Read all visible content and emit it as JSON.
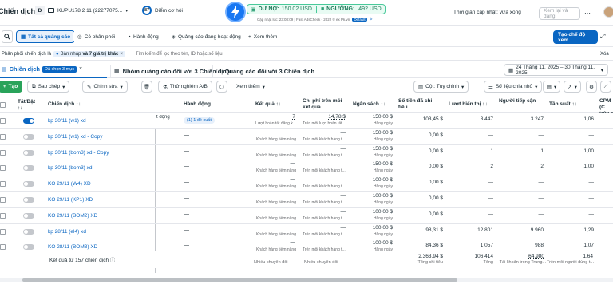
{
  "top": {
    "title": "Chiến dịch",
    "account_badge": "D",
    "account_name": "KUPU178 2 11 (22277075...",
    "opp_score": "87",
    "opp_label": "Điểm cơ hội",
    "debt_label": "DƯ NỢ:",
    "debt_value": "150.02 USD",
    "threshold_label": "NGƯỠNG:",
    "threshold_value": "492 USD",
    "updated_sub": "Cập nhật lúc: 23:08:09 | Fast AdsCheck - 2022 © ex Pk.vn",
    "default_pill": "Default",
    "update_time_label": "Thời gian cập nhật: vừa xong",
    "review_edit_btn": "Xem lại và đăng"
  },
  "tabs_bar": {
    "all_ads": "Tất cả quảng cáo",
    "having_delivery": "Có phân phối",
    "actions": "Hành động",
    "active_ads": "Quảng cáo đang hoạt động",
    "see_more": "Xem thêm",
    "create_view": "Tạo chế độ xem"
  },
  "filter_bar": {
    "filter_prefix": "Phân phối chiến dịch là",
    "filter_value_a": "Bản nháp",
    "filter_value_b": "và 7 giá trị khác",
    "search_placeholder": "Tìm kiếm để lọc theo tên, ID hoặc số liệu",
    "clear": "Xóa"
  },
  "level_tabs": {
    "campaigns": "Chiến dịch",
    "selected": "Đã chọn 3 mục",
    "adsets": "Nhóm quảng cáo đối với 3 Chiến dịch",
    "ads": "Quảng cáo đối với 3 Chiến dịch",
    "date_range": "24 Tháng 11, 2025 – 30 Tháng 11, 2025"
  },
  "toolbar": {
    "create": "Tạo",
    "duplicate": "Sao chép",
    "edit": "Chỉnh sửa",
    "ab_test": "Thử nghiệm A/B",
    "see_more": "Xem thêm",
    "columns": "Cột: Tùy chỉnh",
    "breakdown": "Số liệu chia nhỏ"
  },
  "columns": {
    "onoff": "Tắt/Bật",
    "campaign": "Chiến dịch",
    "action": "Hành động",
    "results": "Kết quả",
    "cost_per_result": "Chi phí trên mỗi kết quả",
    "budget": "Ngân sách",
    "amount_spent": "Số tiền đã chi tiêu",
    "impressions": "Lượt hiển thị",
    "reach": "Người tiếp cận",
    "frequency": "Tần suất",
    "cpm": "CPM (C trên m"
  },
  "rows": [
    {
      "name": "kp 30/11 (w1) xd",
      "on": true,
      "action": "(1) 1 đề xuất",
      "action_left": "t động",
      "results": "7",
      "results_sub": "Lượt hoàn tất đăng k...",
      "cpr": "14,78 $",
      "cpr_sub": "Trên mỗi lượt hoàn tất...",
      "budget": "150,00 $",
      "budget_sub": "Hằng ngày",
      "spent": "103,45 $",
      "impr": "3.447",
      "reach": "3.247",
      "freq": "1,06"
    },
    {
      "name": "kp 30/11 (w1) xd - Copy",
      "on": false,
      "action": "—",
      "action_left": "",
      "results": "—",
      "results_sub": "Khách hàng tiềm năng",
      "cpr": "—",
      "cpr_sub": "Trên mỗi khách hàng t...",
      "budget": "150,00 $",
      "budget_sub": "Hằng ngày",
      "spent": "0,00 $",
      "impr": "—",
      "reach": "—",
      "freq": "—"
    },
    {
      "name": "kp 30/11 (bom3) xd - Copy",
      "on": false,
      "action": "—",
      "action_left": "",
      "results": "—",
      "results_sub": "Khách hàng tiềm năng",
      "cpr": "—",
      "cpr_sub": "Trên mỗi khách hàng t...",
      "budget": "150,00 $",
      "budget_sub": "Hằng ngày",
      "spent": "0,00 $",
      "impr": "1",
      "reach": "1",
      "freq": "1,00"
    },
    {
      "name": "kp 30/11 (bom3) xd",
      "on": false,
      "action": "—",
      "action_left": "",
      "results": "—",
      "results_sub": "Khách hàng tiềm năng",
      "cpr": "—",
      "cpr_sub": "Trên mỗi khách hàng t...",
      "budget": "150,00 $",
      "budget_sub": "Hằng ngày",
      "spent": "0,00 $",
      "impr": "2",
      "reach": "2",
      "freq": "1,00"
    },
    {
      "name": "KO 29/11 (W4) XD",
      "on": false,
      "action": "—",
      "action_left": "",
      "results": "—",
      "results_sub": "Khách hàng tiềm năng",
      "cpr": "—",
      "cpr_sub": "Trên mỗi khách hàng t...",
      "budget": "100,00 $",
      "budget_sub": "Hằng ngày",
      "spent": "0,00 $",
      "impr": "—",
      "reach": "—",
      "freq": "—"
    },
    {
      "name": "KO 29/11 (KP1) XD",
      "on": false,
      "action": "—",
      "action_left": "",
      "results": "—",
      "results_sub": "Khách hàng tiềm năng",
      "cpr": "—",
      "cpr_sub": "Trên mỗi khách hàng t...",
      "budget": "100,00 $",
      "budget_sub": "Hằng ngày",
      "spent": "0,00 $",
      "impr": "—",
      "reach": "—",
      "freq": "—"
    },
    {
      "name": "KO 29/11 (BOM2) XD",
      "on": false,
      "action": "—",
      "action_left": "",
      "results": "—",
      "results_sub": "Khách hàng tiềm năng",
      "cpr": "—",
      "cpr_sub": "Trên mỗi khách hàng t...",
      "budget": "100,00 $",
      "budget_sub": "Hằng ngày",
      "spent": "0,00 $",
      "impr": "—",
      "reach": "—",
      "freq": "—"
    },
    {
      "name": "kp 28/11 (el4) xd",
      "on": false,
      "action": "—",
      "action_left": "",
      "results": "—",
      "results_sub": "Khách hàng tiềm năng",
      "cpr": "—",
      "cpr_sub": "Trên mỗi khách hàng t...",
      "budget": "100,00 $",
      "budget_sub": "Hằng ngày",
      "spent": "98,31 $",
      "impr": "12.801",
      "reach": "9.960",
      "freq": "1,29"
    },
    {
      "name": "KO 28/11 (BOM3) XD",
      "on": false,
      "action": "—",
      "action_left": "",
      "results": "—",
      "results_sub": "Khách hàng tiềm năng",
      "cpr": "—",
      "cpr_sub": "Trên mỗi khách hàng t...",
      "budget": "100,00 $",
      "budget_sub": "Hằng ngày",
      "spent": "84,36 $",
      "impr": "1.057",
      "reach": "988",
      "freq": "1,07"
    }
  ],
  "totals": {
    "label": "Kết quả từ 157 chiến dịch",
    "results_sub": "Nhiều chuyển đổi",
    "cpr_sub": "Nhiều chuyển đổi",
    "spent": "2.363,94 $",
    "spent_sub": "Tổng chi tiêu",
    "impr": "106.414",
    "impr_sub": "Tổng",
    "reach": "64.980",
    "reach_sub": "Tài khoản trong Trung...",
    "freq": "1,64",
    "freq_sub": "Trên mỗi người dùng t..."
  }
}
